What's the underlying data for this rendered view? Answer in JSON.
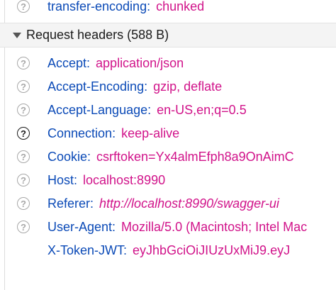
{
  "top_row": {
    "name": "transfer-encoding:",
    "value": "chunked"
  },
  "section": {
    "title": "Request headers (588 B)"
  },
  "headers": [
    {
      "name": "Accept:",
      "value": "application/json",
      "has_help": true,
      "help_active": false,
      "italic": false
    },
    {
      "name": "Accept-Encoding:",
      "value": "gzip, deflate",
      "has_help": true,
      "help_active": false,
      "italic": false
    },
    {
      "name": "Accept-Language:",
      "value": "en-US,en;q=0.5",
      "has_help": true,
      "help_active": false,
      "italic": false
    },
    {
      "name": "Connection:",
      "value": "keep-alive",
      "has_help": true,
      "help_active": true,
      "italic": false
    },
    {
      "name": "Cookie:",
      "value": "csrftoken=Yx4almEfph8a9OnAimC",
      "has_help": true,
      "help_active": false,
      "italic": false
    },
    {
      "name": "Host:",
      "value": "localhost:8990",
      "has_help": true,
      "help_active": false,
      "italic": false
    },
    {
      "name": "Referer:",
      "value": "http://localhost:8990/swagger-ui",
      "has_help": true,
      "help_active": false,
      "italic": true
    },
    {
      "name": "User-Agent:",
      "value": "Mozilla/5.0 (Macintosh; Intel Mac",
      "has_help": true,
      "help_active": false,
      "italic": false
    },
    {
      "name": "X-Token-JWT:",
      "value": "eyJhbGciOiJIUzUxMiJ9.eyJ",
      "has_help": false,
      "help_active": false,
      "italic": false
    }
  ],
  "icons": {
    "help": "question-circle-icon",
    "twisty": "triangle-down-icon",
    "help_glyph": "?"
  },
  "colors": {
    "header_name": "#0b4ab7",
    "header_value": "#d1138a",
    "section_bg": "#f4f4f4"
  }
}
